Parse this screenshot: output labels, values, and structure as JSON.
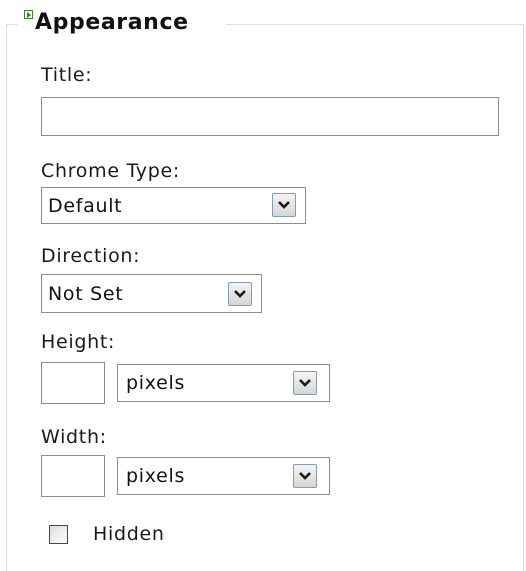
{
  "section": {
    "title": "Appearance",
    "expand_icon": "expand-arrow-icon"
  },
  "form": {
    "title_label": "Title:",
    "title_value": "",
    "chrome_type_label": "Chrome Type:",
    "chrome_type_value": "Default",
    "direction_label": "Direction:",
    "direction_value": "Not Set",
    "height_label": "Height:",
    "height_value": "",
    "height_unit": "pixels",
    "width_label": "Width:",
    "width_value": "",
    "width_unit": "pixels",
    "hidden_label": "Hidden",
    "hidden_checked": false
  },
  "icons": {
    "dropdown": "chevron-down-icon"
  },
  "colors": {
    "border": "#8c8c8c",
    "dropdown_button_border": "#7f9db9",
    "checkbox_border": "#1c5180",
    "expand_icon": "#2e7d1f"
  }
}
